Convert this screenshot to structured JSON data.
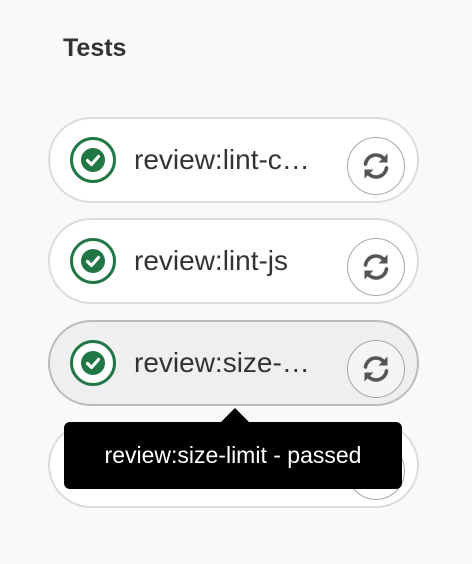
{
  "panel": {
    "title": "Tests"
  },
  "jobs": [
    {
      "name": "review:lint-c…",
      "status": "passed"
    },
    {
      "name": "review:lint-js",
      "status": "passed"
    },
    {
      "name": "review:size-…",
      "status": "passed"
    },
    {
      "name": "",
      "status": "passed"
    }
  ],
  "tooltip": {
    "text": "review:size-limit - passed"
  },
  "colors": {
    "success": "#217645",
    "retry_icon": "#555555",
    "tooltip_bg": "#000000"
  },
  "icons": {
    "status": "check-circle-icon",
    "retry": "retry-icon"
  }
}
